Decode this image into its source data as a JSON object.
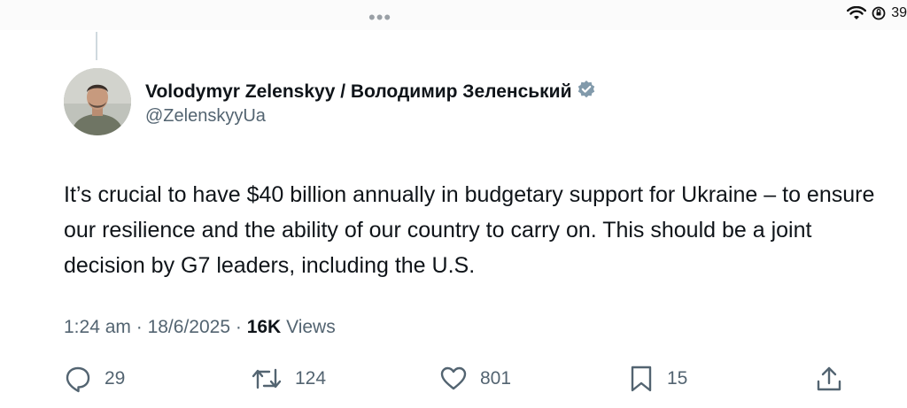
{
  "status_bar": {
    "menu_dots": "•••",
    "battery": "39"
  },
  "tweet": {
    "author_name": "Volodymyr Zelenskyy / Володимир Зеленський",
    "handle": "@ZelenskyyUa",
    "verified": true,
    "text": "It’s crucial to have $40 billion annually in budgetary support for Ukraine – to ensure our resilience and the ability of our country to carry on. This should be a joint decision by G7 leaders, including the U.S.",
    "time": "1:24 am",
    "separator": "·",
    "date": "18/6/2025",
    "views_count": "16K",
    "views_label": "Views"
  },
  "actions": {
    "replies": "29",
    "reposts": "124",
    "likes": "801",
    "bookmarks": "15"
  },
  "colors": {
    "text": "#0f1419",
    "secondary": "#536471",
    "verified_badge": "#829aab"
  }
}
